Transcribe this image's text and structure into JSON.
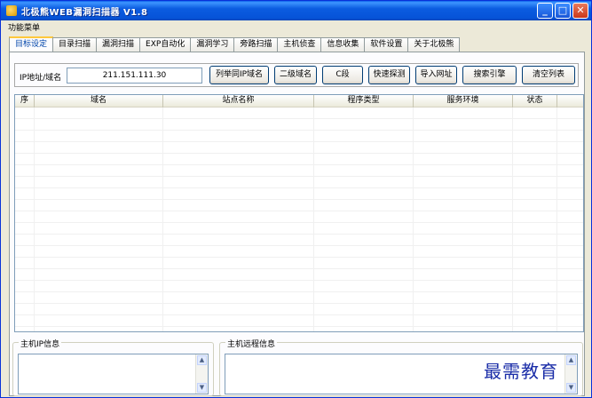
{
  "window": {
    "title": "北极熊WEB漏洞扫描器 V1.8",
    "controls": {
      "minimize": "_",
      "maximize": "□",
      "close": "✕"
    }
  },
  "menubar": {
    "items": [
      {
        "label": "功能菜单"
      }
    ]
  },
  "tabs": [
    {
      "label": "目标设定",
      "active": true
    },
    {
      "label": "目录扫描"
    },
    {
      "label": "漏洞扫描"
    },
    {
      "label": "EXP自动化"
    },
    {
      "label": "漏洞学习"
    },
    {
      "label": "旁路扫描"
    },
    {
      "label": "主机侦查"
    },
    {
      "label": "信息收集"
    },
    {
      "label": "软件设置"
    },
    {
      "label": "关于北极熊"
    }
  ],
  "target": {
    "ip_label": "IP地址/域名",
    "ip_value": "211.151.111.30",
    "buttons": [
      {
        "label": "列举同IP域名"
      },
      {
        "label": "二级域名"
      },
      {
        "label": "C段"
      },
      {
        "label": "快速探测"
      },
      {
        "label": "导入网址"
      },
      {
        "label": "搜索引擎"
      },
      {
        "label": "清空列表"
      }
    ]
  },
  "table": {
    "columns": [
      {
        "label": "序"
      },
      {
        "label": "域名"
      },
      {
        "label": "站点名称"
      },
      {
        "label": "程序类型"
      },
      {
        "label": "服务环境"
      },
      {
        "label": "状态"
      }
    ],
    "rows": []
  },
  "host_ip_info": {
    "title": "主机IP信息"
  },
  "host_remote_info": {
    "title": "主机远程信息"
  },
  "watermark": "最需教育",
  "colors": {
    "titlebar": "#0653d8",
    "active_tab_accent": "#ffc83c",
    "watermark": "#1a2da8"
  }
}
